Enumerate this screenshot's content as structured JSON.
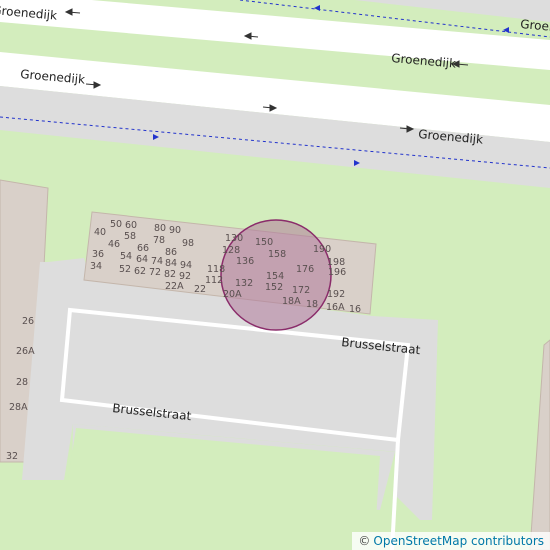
{
  "streets": {
    "groenedijk_partial": "Groenedijk",
    "groenedijk_mid_right": "Groenedijk",
    "groenedijk_left": "Groenedijk",
    "groenedijk_lower_right": "Groenedijk",
    "groenedijk_partial_right": "Groenedijk",
    "brusselstraat_right": "Brusselstraat",
    "brusselstraat_left": "Brusselstraat"
  },
  "house_numbers": {
    "n50": "50",
    "n60": "60",
    "n80": "80",
    "n90": "90",
    "n40": "40",
    "n58": "58",
    "n78": "78",
    "n98": "98",
    "n46": "46",
    "n66": "66",
    "n36": "36",
    "n86": "86",
    "n54": "54",
    "n64": "64",
    "n74": "74",
    "n84": "84",
    "n94": "94",
    "n34": "34",
    "n52": "52",
    "n62": "62",
    "n72": "72",
    "n82": "82",
    "n92": "92",
    "n22A": "22A",
    "n22": "22",
    "n130": "130",
    "n150": "150",
    "n128": "128",
    "n158": "158",
    "n190": "190",
    "n136": "136",
    "n198": "198",
    "n118": "118",
    "n176": "176",
    "n196": "196",
    "n154": "154",
    "n112": "112",
    "n132": "132",
    "n152": "152",
    "n172": "172",
    "n20A": "20A",
    "n192": "192",
    "n18A": "18A",
    "n18": "18",
    "n16A": "16A",
    "n16": "16",
    "n26": "26",
    "n26A": "26A",
    "n28": "28",
    "n28A": "28A",
    "n32": "32"
  },
  "attribution": {
    "copyright_symbol": "©",
    "text": "OpenStreetMap contributors"
  },
  "colors": {
    "landuse_grass": "#d3edbd",
    "road_gray": "#dddddd",
    "road_white": "#ffffff",
    "building": "#d9d0c9",
    "building_outline": "#c4b6ab",
    "marker_fill": "#b07a9b",
    "marker_stroke": "#8a2c6a",
    "cycleway_blue": "#2233cc"
  }
}
